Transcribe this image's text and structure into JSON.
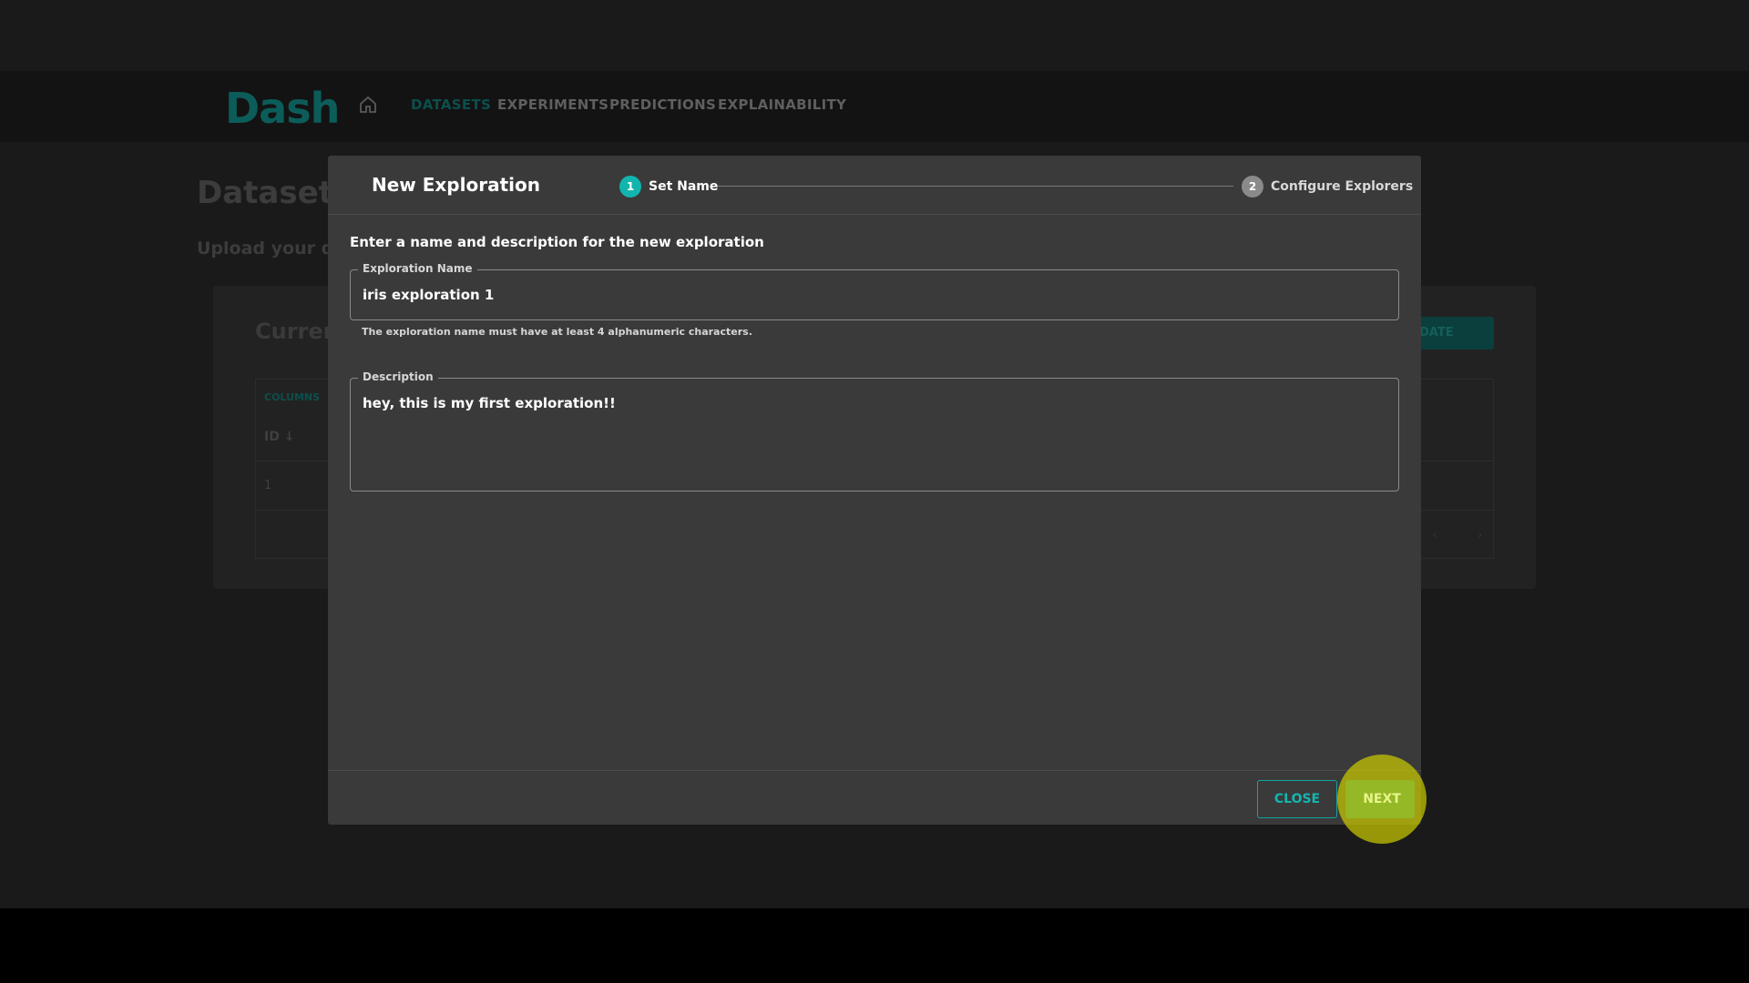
{
  "app": {
    "logo": "Dash",
    "nav": [
      "DATASETS",
      "EXPERIMENTS",
      "PREDICTIONS",
      "EXPLAINABILITY"
    ],
    "page_title": "Dataset",
    "page_subtitle": "Upload your da",
    "card_title": "Current",
    "update_button": "DATE",
    "columns_label": "COLUMNS",
    "id_header": "ID ↓",
    "row_id": "1",
    "pager": "‹ ›"
  },
  "modal": {
    "title": "New Exploration",
    "steps": [
      {
        "number": "1",
        "label": "Set Name",
        "active": true
      },
      {
        "number": "2",
        "label": "Configure Explorers",
        "active": false
      }
    ],
    "instructions": "Enter a name and description for the new exploration",
    "name_field": {
      "label": "Exploration Name",
      "value": "iris exploration 1",
      "helper": "The exploration name must have at least 4 alphanumeric characters."
    },
    "description_field": {
      "label": "Description",
      "value": "hey, this is my first exploration!!"
    },
    "close_label": "CLOSE",
    "next_label": "NEXT"
  },
  "colors": {
    "accent": "#12b5ae",
    "modal_bg": "#3a3a3a",
    "highlight": "#c8c800"
  }
}
